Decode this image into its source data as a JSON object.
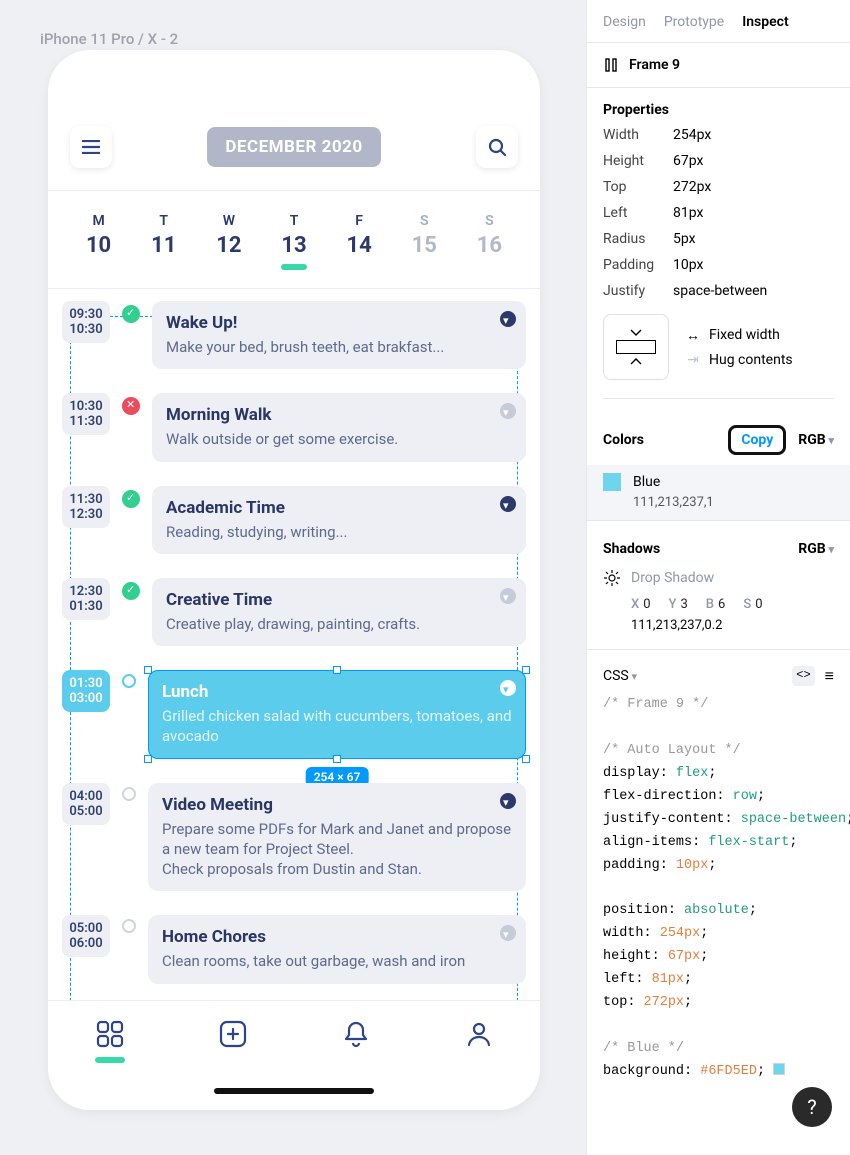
{
  "canvas": {
    "frame_label": "iPhone 11 Pro / X - 2"
  },
  "phone": {
    "month": "DECEMBER 2020",
    "week": [
      {
        "d": "M",
        "n": "10",
        "state": "active"
      },
      {
        "d": "T",
        "n": "11",
        "state": "active"
      },
      {
        "d": "W",
        "n": "12",
        "state": "active"
      },
      {
        "d": "T",
        "n": "13",
        "state": "today"
      },
      {
        "d": "F",
        "n": "14",
        "state": "active"
      },
      {
        "d": "S",
        "n": "15",
        "state": ""
      },
      {
        "d": "S",
        "n": "16",
        "state": ""
      }
    ],
    "events": [
      {
        "t1": "09:30",
        "t2": "10:30",
        "status": "done",
        "title": "Wake Up!",
        "desc": "Make your bed, brush teeth, eat brakfast...",
        "chev": "dark",
        "selected": false
      },
      {
        "t1": "10:30",
        "t2": "11:30",
        "status": "fail",
        "title": "Morning Walk",
        "desc": "Walk outside or get some exercise.",
        "chev": "dim",
        "selected": false
      },
      {
        "t1": "11:30",
        "t2": "12:30",
        "status": "done",
        "title": "Academic Time",
        "desc": "Reading, studying, writing...",
        "chev": "dark",
        "selected": false
      },
      {
        "t1": "12:30",
        "t2": "01:30",
        "status": "done",
        "title": "Creative Time",
        "desc": "Creative play, drawing, painting, crafts.",
        "chev": "dim",
        "selected": false
      },
      {
        "t1": "01:30",
        "t2": "03:00",
        "status": "emptyblue",
        "title": "Lunch",
        "desc": "Grilled chicken salad with cucumbers, tomatoes, and avocado",
        "chev": "dark",
        "selected": true,
        "dim_badge": "254 × 67"
      },
      {
        "t1": "04:00",
        "t2": "05:00",
        "status": "empty",
        "title": "Video Meeting",
        "desc": "Prepare some PDFs for Mark and Janet and propose a new team for Project Steel.\nCheck proposals from Dustin and Stan.",
        "chev": "dark",
        "selected": false
      },
      {
        "t1": "05:00",
        "t2": "06:00",
        "status": "empty",
        "title": "Home Chores",
        "desc": "Clean rooms, take out garbage, wash and iron",
        "chev": "dim",
        "selected": false
      }
    ]
  },
  "inspector": {
    "tabs": [
      "Design",
      "Prototype",
      "Inspect"
    ],
    "active_tab": "Inspect",
    "frame_name": "Frame 9",
    "section_properties": "Properties",
    "props": [
      [
        "Width",
        "254px"
      ],
      [
        "Height",
        "67px"
      ],
      [
        "Top",
        "272px"
      ],
      [
        "Left",
        "81px"
      ],
      [
        "Radius",
        "5px"
      ],
      [
        "Padding",
        "10px"
      ],
      [
        "Justify",
        "space-between"
      ]
    ],
    "constraint": {
      "fixed": "Fixed width",
      "hug": "Hug contents"
    },
    "colors_title": "Colors",
    "copy_label": "Copy",
    "color_format": "RGB",
    "color": {
      "name": "Blue",
      "value": "111,213,237,1"
    },
    "shadows_title": "Shadows",
    "shadow_format": "RGB",
    "shadow": {
      "name": "Drop Shadow",
      "x": "0",
      "y": "3",
      "b": "6",
      "s": "0",
      "color": "111,213,237,0.2"
    },
    "css_label": "CSS",
    "css_lines": [
      {
        "type": "comment",
        "text": "/* Frame 9 */"
      },
      {
        "type": "blank",
        "text": ""
      },
      {
        "type": "comment",
        "text": "/* Auto Layout */"
      },
      {
        "type": "decl",
        "prop": "display",
        "val": "flex",
        "vclass": "c-val"
      },
      {
        "type": "decl",
        "prop": "flex-direction",
        "val": "row",
        "vclass": "c-val"
      },
      {
        "type": "decl",
        "prop": "justify-content",
        "val": "space-between",
        "vclass": "c-val"
      },
      {
        "type": "decl",
        "prop": "align-items",
        "val": "flex-start",
        "vclass": "c-val"
      },
      {
        "type": "decl",
        "prop": "padding",
        "val": "10px",
        "vclass": "c-num"
      },
      {
        "type": "blank",
        "text": ""
      },
      {
        "type": "decl",
        "prop": "position",
        "val": "absolute",
        "vclass": "c-val"
      },
      {
        "type": "decl",
        "prop": "width",
        "val": "254px",
        "vclass": "c-num"
      },
      {
        "type": "decl",
        "prop": "height",
        "val": "67px",
        "vclass": "c-num"
      },
      {
        "type": "decl",
        "prop": "left",
        "val": "81px",
        "vclass": "c-num"
      },
      {
        "type": "decl",
        "prop": "top",
        "val": "272px",
        "vclass": "c-num"
      },
      {
        "type": "blank",
        "text": ""
      },
      {
        "type": "comment",
        "text": "/* Blue */"
      },
      {
        "type": "declsw",
        "prop": "background",
        "val": "#6FD5ED",
        "vclass": "c-num"
      }
    ]
  }
}
